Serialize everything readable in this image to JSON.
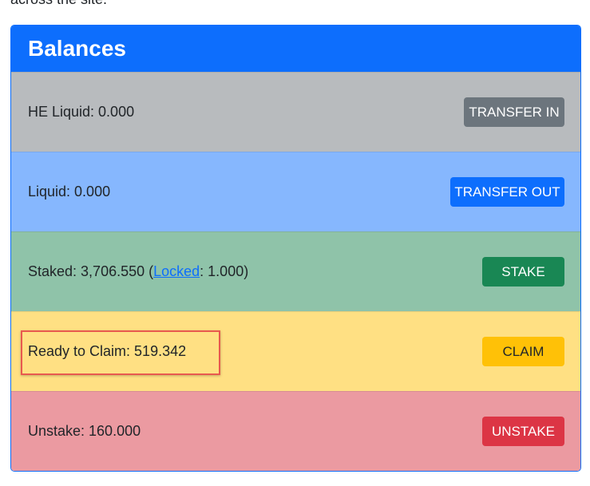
{
  "page": {
    "intro_text": "across the site."
  },
  "balances": {
    "title": "Balances",
    "rows": [
      {
        "label": "HE Liquid: 0.000",
        "button": "TRANSFER IN"
      },
      {
        "label": "Liquid: 0.000",
        "button": "TRANSFER OUT"
      },
      {
        "label_prefix": "Staked: 3,706.550 (",
        "locked_link": "Locked",
        "label_suffix": ": 1.000)",
        "button": "STAKE"
      },
      {
        "label": "Ready to Claim: 519.342",
        "button": "CLAIM"
      },
      {
        "label": "Unstake: 160.000",
        "button": "UNSTAKE"
      }
    ]
  },
  "colors": {
    "header": "#0d6efd",
    "row_he_liquid": "#b8bbbe",
    "row_liquid": "#86b7fe",
    "row_staked": "#8fc3a9",
    "row_claim": "#ffe083",
    "row_unstake": "#eb9aa1",
    "highlight_border": "#e8594f"
  }
}
